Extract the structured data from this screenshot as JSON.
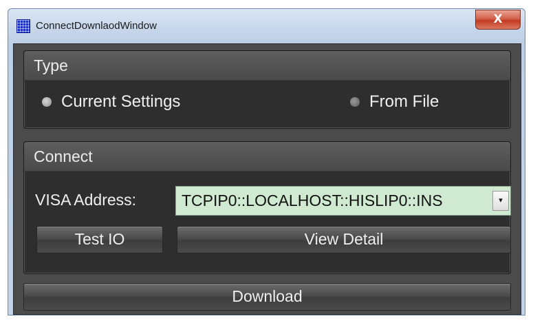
{
  "window": {
    "title": "ConnectDownlaodWindow",
    "close_label": "X"
  },
  "type_group": {
    "title": "Type",
    "options": [
      {
        "label": "Current Settings",
        "selected": true
      },
      {
        "label": "From File",
        "selected": false
      }
    ]
  },
  "connect_group": {
    "title": "Connect",
    "visa_label": "VISA Address:",
    "visa_value": "TCPIP0::LOCALHOST::HISLIP0::INS",
    "dropdown_arrow": "▾",
    "test_io_label": "Test IO",
    "view_detail_label": "View Detail"
  },
  "download_label": "Download",
  "colors": {
    "panel_bg": "#4b4b4b",
    "group_bg": "#2e2e2e",
    "combo_bg": "#cfead1",
    "close_button": "#c43a22"
  }
}
